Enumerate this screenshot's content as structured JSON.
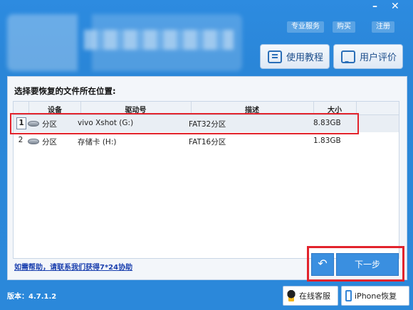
{
  "window": {
    "minimize_icon": "minimize-icon",
    "close_icon": "close-icon"
  },
  "header": {
    "links": [
      "专业服务",
      "购买",
      "注册"
    ],
    "tutorial_label": "使用教程",
    "review_label": "用户评价"
  },
  "panel": {
    "title": "选择要恢复的文件所在位置:",
    "columns": [
      "设备",
      "驱动号",
      "描述",
      "大小"
    ],
    "rows": [
      {
        "num": "1",
        "device": "分区",
        "drive": "vivo Xshot (G:)",
        "desc": "FAT32分区",
        "size": "8.83GB"
      },
      {
        "num": "2",
        "device": "分区",
        "drive": "存储卡 (H:)",
        "desc": "FAT16分区",
        "size": "1.83GB"
      }
    ],
    "help_link": "如需帮助，请联系我们获得7*24协助"
  },
  "nav": {
    "back_icon": "back-arrow-icon",
    "back_glyph": "↶",
    "next_label": "下一步"
  },
  "footer": {
    "version": "版本：4.7.1.2",
    "qq_label": "在线客服",
    "iphone_label": "iPhone恢复"
  },
  "colors": {
    "brand_blue": "#2a86d8",
    "highlight_red": "#e2232c",
    "button_blue": "#3a8fe0"
  }
}
